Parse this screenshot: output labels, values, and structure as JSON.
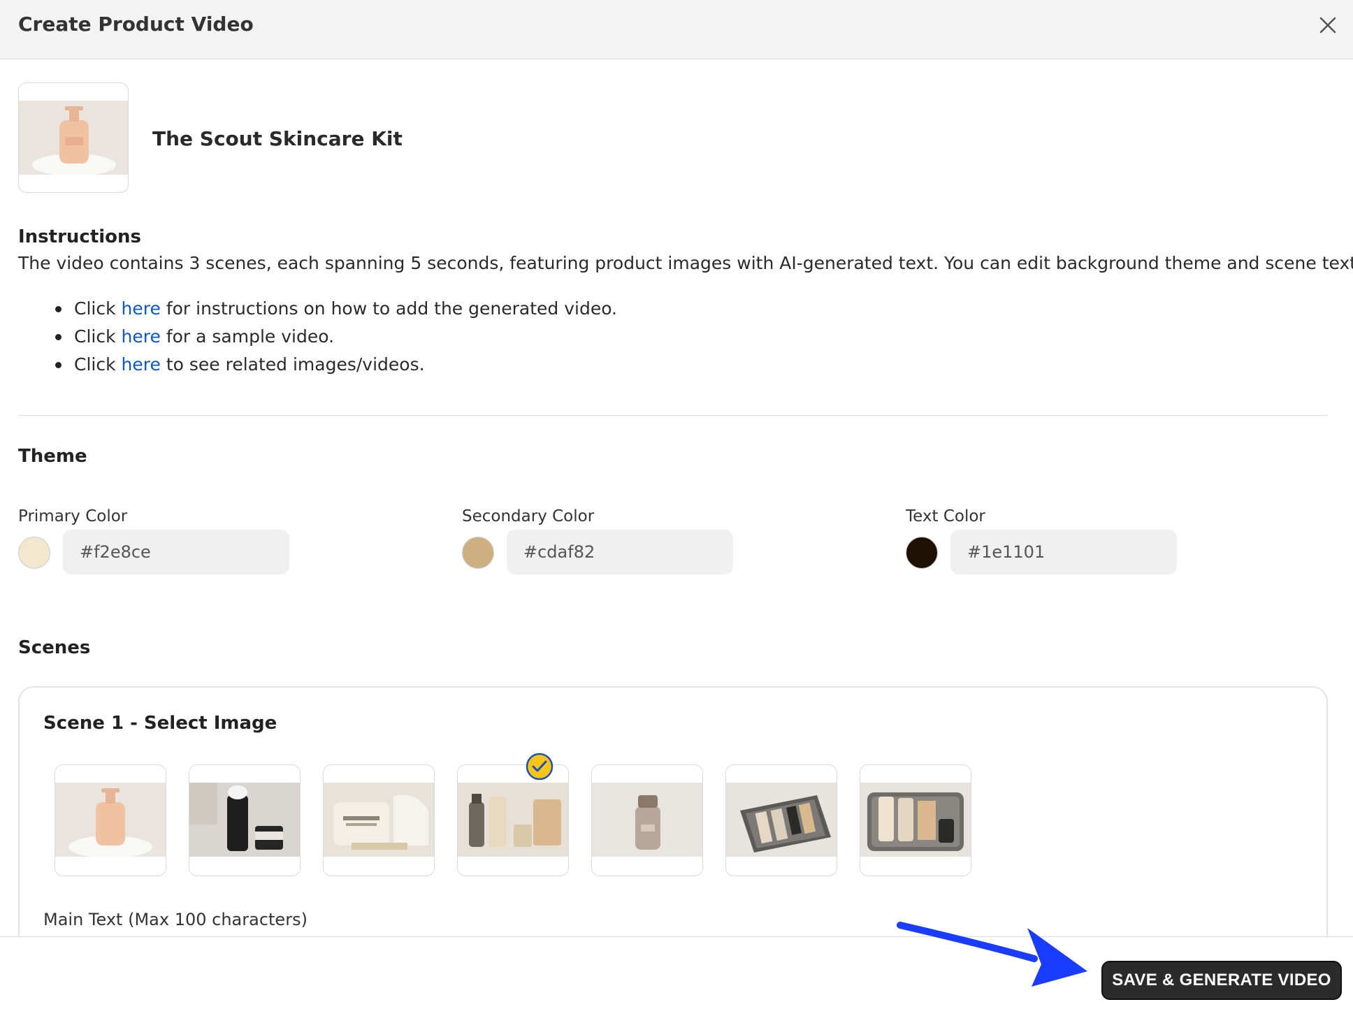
{
  "header": {
    "title": "Create Product Video",
    "close_icon": "close-icon"
  },
  "product": {
    "name": "The Scout Skincare Kit",
    "thumbnail_icon": "face-wash-bottle-image"
  },
  "instructions": {
    "heading": "Instructions",
    "text": "The video contains 3 scenes, each spanning 5 seconds, featuring product images with AI-generated text. You can edit background theme and scene text.",
    "bullets": [
      {
        "prefix": "Click ",
        "link": "here",
        "suffix": " for instructions on how to add the generated video."
      },
      {
        "prefix": "Click ",
        "link": "here",
        "suffix": " for a sample video."
      },
      {
        "prefix": "Click ",
        "link": "here",
        "suffix": " to see related images/videos."
      }
    ]
  },
  "theme": {
    "heading": "Theme",
    "primary": {
      "label": "Primary Color",
      "value": "#f2e8ce",
      "swatch": "#f2e8ce"
    },
    "secondary": {
      "label": "Secondary Color",
      "value": "#cdaf82",
      "swatch": "#cdaf82"
    },
    "text": {
      "label": "Text Color",
      "value": "#1e1101",
      "swatch": "#1e1101"
    }
  },
  "scenes": {
    "heading": "Scenes",
    "scene1": {
      "title": "Scene 1 - Select Image",
      "images": [
        "face-wash-pump-bottle",
        "shaving-cream-and-jar",
        "bamboo-face-wipes",
        "product-set-selected",
        "face-wash-small-bottle",
        "tin-kit-open",
        "tin-kit-closeup"
      ],
      "selected_index": 3,
      "main_text_label": "Main Text (Max 100 characters)"
    }
  },
  "footer": {
    "save_label": "SAVE & GENERATE VIDEO"
  },
  "colors": {
    "accent_link": "#0b57d0",
    "arrow": "#1a3cff",
    "check_badge": "#f5c518"
  }
}
